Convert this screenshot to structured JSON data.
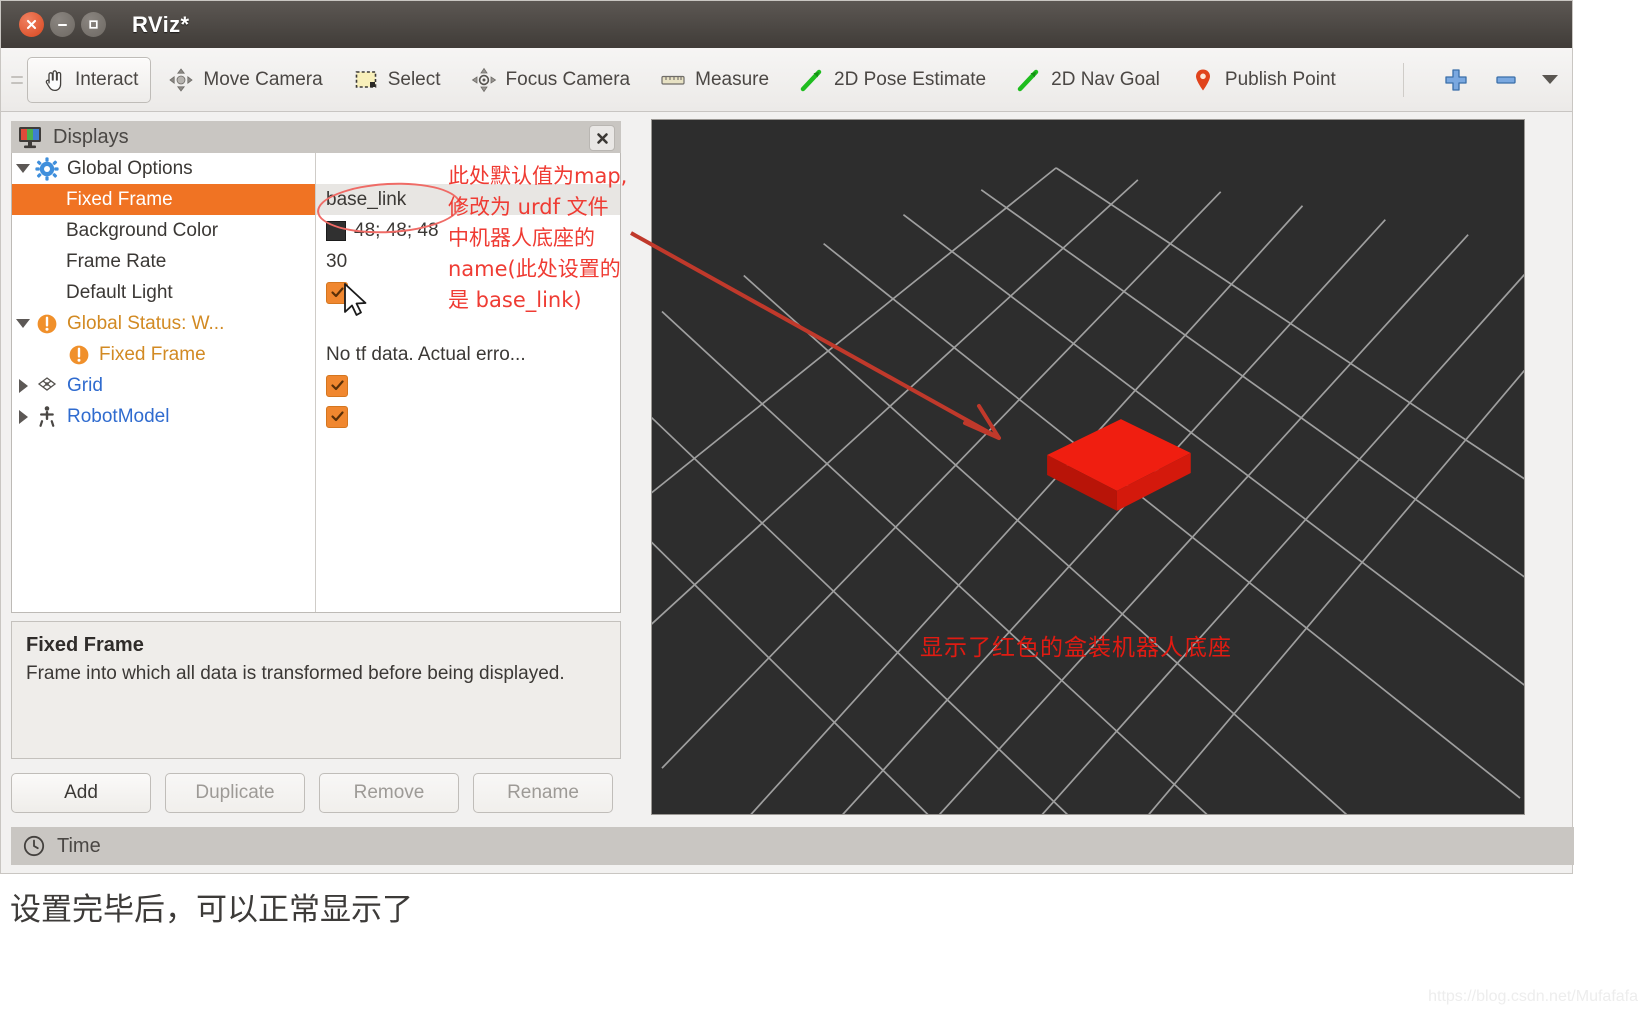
{
  "window": {
    "title": "RViz*",
    "close_tooltip": "Close",
    "minimize_tooltip": "Minimize",
    "maximize_tooltip": "Maximize"
  },
  "toolbar": {
    "items": [
      {
        "label": "Interact",
        "icon": "hand-cursor-icon",
        "active": true
      },
      {
        "label": "Move Camera",
        "icon": "move-camera-icon",
        "active": false
      },
      {
        "label": "Select",
        "icon": "select-rect-icon",
        "active": false
      },
      {
        "label": "Focus Camera",
        "icon": "focus-camera-icon",
        "active": false
      },
      {
        "label": "Measure",
        "icon": "ruler-icon",
        "active": false
      },
      {
        "label": "2D Pose Estimate",
        "icon": "green-arrow-icon",
        "active": false
      },
      {
        "label": "2D Nav Goal",
        "icon": "green-arrow-icon",
        "active": false
      },
      {
        "label": "Publish Point",
        "icon": "map-pin-icon",
        "active": false
      }
    ],
    "add_icon": "plus-icon",
    "remove_icon": "minus-icon",
    "overflow_icon": "chevron-down-icon"
  },
  "displays": {
    "panel_title": "Displays",
    "panel_icon": "monitor-icon",
    "close_icon": "close-icon",
    "tree": [
      {
        "label": "Global Options",
        "icon": "gear-icon",
        "expander": "down",
        "indent": 0,
        "value": "",
        "value_type": "none",
        "selected": false,
        "style": "normal"
      },
      {
        "label": "Fixed Frame",
        "icon": "none",
        "expander": "none",
        "indent": 2,
        "value": "base_link",
        "value_type": "text",
        "selected": true,
        "style": "normal"
      },
      {
        "label": "Background Color",
        "icon": "none",
        "expander": "none",
        "indent": 2,
        "value": "48; 48; 48",
        "value_type": "color",
        "selected": false,
        "style": "normal"
      },
      {
        "label": "Frame Rate",
        "icon": "none",
        "expander": "none",
        "indent": 2,
        "value": "30",
        "value_type": "text",
        "selected": false,
        "style": "normal"
      },
      {
        "label": "Default Light",
        "icon": "none",
        "expander": "none",
        "indent": 2,
        "value": "checked",
        "value_type": "checkbox",
        "selected": false,
        "style": "normal"
      },
      {
        "label": "Global Status: W...",
        "icon": "warning-icon",
        "expander": "down",
        "indent": 0,
        "value": "",
        "value_type": "none",
        "selected": false,
        "style": "warn"
      },
      {
        "label": "Fixed Frame",
        "icon": "warning-icon",
        "expander": "none",
        "indent": 1,
        "value": "No tf data.  Actual erro...",
        "value_type": "text",
        "selected": false,
        "style": "warn"
      },
      {
        "label": "Grid",
        "icon": "grid-icon",
        "expander": "right",
        "indent": 0,
        "value": "checked",
        "value_type": "checkbox",
        "selected": false,
        "style": "link"
      },
      {
        "label": "RobotModel",
        "icon": "robot-icon",
        "expander": "right",
        "indent": 0,
        "value": "checked",
        "value_type": "checkbox",
        "selected": false,
        "style": "link"
      }
    ],
    "description": {
      "title": "Fixed Frame",
      "body": "Frame into which all data is transformed before being displayed."
    },
    "buttons": [
      {
        "label": "Add",
        "enabled": true
      },
      {
        "label": "Duplicate",
        "enabled": false
      },
      {
        "label": "Remove",
        "enabled": false
      },
      {
        "label": "Rename",
        "enabled": false
      }
    ]
  },
  "time_panel": {
    "label": "Time",
    "icon": "clock-icon"
  },
  "viewport": {
    "caption": "显示了红色的盒装机器人底座",
    "caption_color": "#e01b12",
    "background_color": "#2d2d2d",
    "grid_color": "#b4b4b4",
    "robot_color": "#e61b10",
    "collapse_left_icon": "chevron-left-icon",
    "collapse_right_icon": "chevron-right-icon"
  },
  "annotation": {
    "color": "#ef3b33",
    "lines": [
      "此处默认值为map,",
      "修改为 urdf 文件",
      "中机器人底座的",
      "name(此处设置的",
      "是 base_link)"
    ],
    "ellipse_target": "base_link",
    "arrow": "points-to-robot-model"
  },
  "page": {
    "caption": "设置完毕后，可以正常显示了",
    "watermark": "https://blog.csdn.net/Mufafafa"
  }
}
